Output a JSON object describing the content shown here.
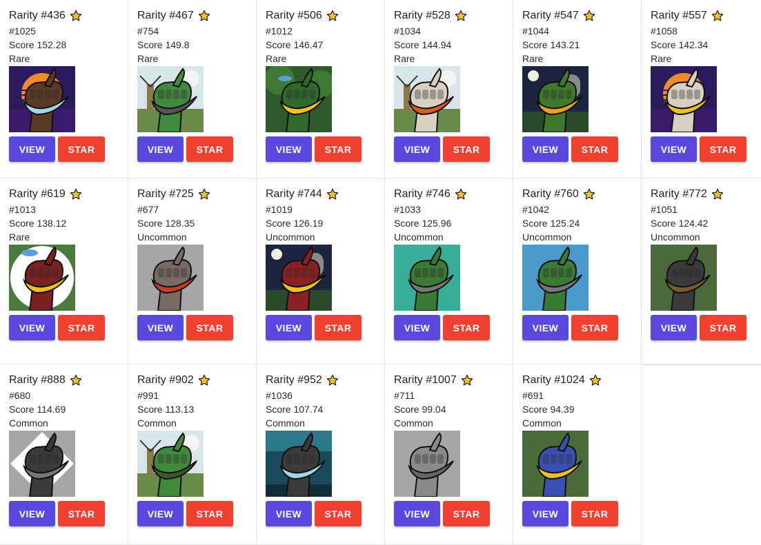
{
  "labels": {
    "rank_prefix": "Rarity ",
    "score_prefix": "Score ",
    "view_label": "VIEW",
    "star_label": "STAR"
  },
  "colors": {
    "view_button": "#5a48df",
    "star_button": "#f0402f",
    "star_icon": "#f7c21c"
  },
  "cards": [
    {
      "rank": "#436",
      "id": "#1025",
      "score": "152.28",
      "rarity": "Rare",
      "image": {
        "bg": "#2b1a5c",
        "bg2": "#f08a2b",
        "hand": "#5a3a24",
        "item": "#9fd6e8",
        "style": "sunset"
      },
      "star_icon": "star-icon"
    },
    {
      "rank": "#467",
      "id": "#754",
      "score": "149.8",
      "rarity": "Rare",
      "image": {
        "bg": "#d8e6ea",
        "bg2": "#8a7a4a",
        "hand": "#3f8a3c",
        "item": "#555555",
        "style": "windmill"
      },
      "star_icon": "star-icon"
    },
    {
      "rank": "#506",
      "id": "#1012",
      "score": "146.47",
      "rarity": "Rare",
      "image": {
        "bg": "#2f5a2c",
        "bg2": "#5aa0d8",
        "hand": "#2f6a2a",
        "item": "#f0c020",
        "style": "jungle"
      },
      "star_icon": "star-icon"
    },
    {
      "rank": "#528",
      "id": "#1034",
      "score": "144.94",
      "rarity": "Rare",
      "image": {
        "bg": "#d8e6ea",
        "bg2": "#8a7a4a",
        "hand": "#d8d0c0",
        "item": "#e05a20",
        "style": "windmill"
      },
      "star_icon": "star-icon"
    },
    {
      "rank": "#547",
      "id": "#1044",
      "score": "143.21",
      "rarity": "Rare",
      "image": {
        "bg": "#1c2440",
        "bg2": "#2a4a2a",
        "hand": "#3f7a2c",
        "item": "#f0a020",
        "style": "grave"
      },
      "star_icon": "star-icon"
    },
    {
      "rank": "#557",
      "id": "#1058",
      "score": "142.34",
      "rarity": "Rare",
      "image": {
        "bg": "#2b1a5c",
        "bg2": "#f08a2b",
        "hand": "#d8d0c0",
        "item": "#f0c020",
        "style": "sunset"
      },
      "star_icon": "star-icon"
    },
    {
      "rank": "#619",
      "id": "#1013",
      "score": "138.12",
      "rarity": "Rare",
      "image": {
        "bg": "#4a7a3c",
        "bg2": "#ffffff",
        "hand": "#7a2020",
        "item": "#f0c020",
        "style": "circle"
      },
      "star_icon": "star-icon"
    },
    {
      "rank": "#725",
      "id": "#677",
      "score": "128.35",
      "rarity": "Uncommon",
      "image": {
        "bg": "#a6a6a6",
        "bg2": "#a6a6a6",
        "hand": "#7a6a66",
        "item": "#c83a2a",
        "style": "plain"
      },
      "star_icon": "star-icon"
    },
    {
      "rank": "#744",
      "id": "#1019",
      "score": "126.19",
      "rarity": "Uncommon",
      "image": {
        "bg": "#1c2440",
        "bg2": "#2a4a2a",
        "hand": "#8a2020",
        "item": "#f0c020",
        "style": "grave"
      },
      "star_icon": "star-icon"
    },
    {
      "rank": "#746",
      "id": "#1033",
      "score": "125.96",
      "rarity": "Uncommon",
      "image": {
        "bg": "#38ad98",
        "bg2": "#38ad98",
        "hand": "#3a7a34",
        "item": "#777777",
        "style": "plain"
      },
      "star_icon": "star-icon"
    },
    {
      "rank": "#760",
      "id": "#1042",
      "score": "125.24",
      "rarity": "Uncommon",
      "image": {
        "bg": "#4a9acb",
        "bg2": "#4a9acb",
        "hand": "#3a7a34",
        "item": "#777777",
        "style": "plain"
      },
      "star_icon": "star-icon"
    },
    {
      "rank": "#772",
      "id": "#1051",
      "score": "124.42",
      "rarity": "Uncommon",
      "image": {
        "bg": "#4a6a3a",
        "bg2": "#4a6a3a",
        "hand": "#3a3a3a",
        "item": "#7a5a2a",
        "style": "plain"
      },
      "star_icon": "star-icon"
    },
    {
      "rank": "#888",
      "id": "#680",
      "score": "114.69",
      "rarity": "Common",
      "image": {
        "bg": "#a6a6a6",
        "bg2": "#ffffff",
        "hand": "#3a3a3a",
        "item": "#777777",
        "style": "diamond"
      },
      "star_icon": "star-icon"
    },
    {
      "rank": "#902",
      "id": "#991",
      "score": "113.13",
      "rarity": "Common",
      "image": {
        "bg": "#d8e6ea",
        "bg2": "#8a7a4a",
        "hand": "#3f8a3c",
        "item": "#3a5a2a",
        "style": "windmill"
      },
      "star_icon": "star-icon"
    },
    {
      "rank": "#952",
      "id": "#1036",
      "score": "107.74",
      "rarity": "Common",
      "image": {
        "bg": "#1a4a5c",
        "bg2": "#2a7a8a",
        "hand": "#3a3a3a",
        "item": "#9fd6e8",
        "style": "water"
      },
      "star_icon": "star-icon"
    },
    {
      "rank": "#1007",
      "id": "#711",
      "score": "99.04",
      "rarity": "Common",
      "image": {
        "bg": "#a6a6a6",
        "bg2": "#a6a6a6",
        "hand": "#8a8a8a",
        "item": "#666666",
        "style": "plain"
      },
      "star_icon": "star-icon"
    },
    {
      "rank": "#1024",
      "id": "#691",
      "score": "94.39",
      "rarity": "Common",
      "image": {
        "bg": "#4a6a3a",
        "bg2": "#4a6a3a",
        "hand": "#3a50b0",
        "item": "#f0c020",
        "style": "plain"
      },
      "star_icon": "star-icon"
    }
  ]
}
